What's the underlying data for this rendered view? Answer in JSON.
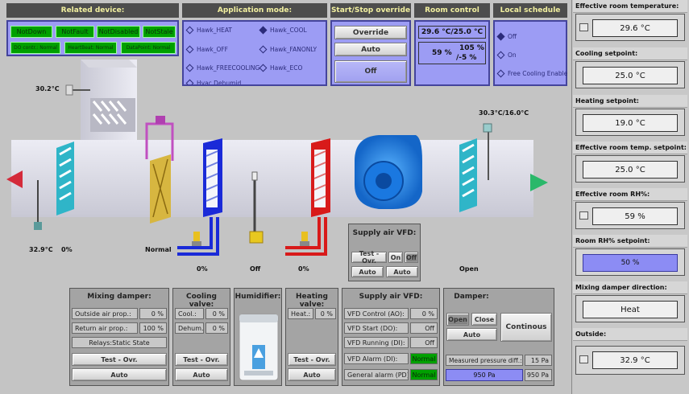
{
  "related_device": {
    "title": "Related device:",
    "status": [
      "NotDown",
      "NotFault",
      "NotDisabled",
      "NotStale"
    ],
    "info": [
      "DO contr.: Normal",
      "HeartBeat: Normal",
      "DataPoint: Normal"
    ]
  },
  "application_mode": {
    "title": "Application mode:",
    "options": [
      "Hawk_HEAT",
      "Hawk_COOL",
      "Hawk_OFF",
      "Hawk_FANONLY",
      "Hawk_FREECOOLING",
      "Hawk_ECO",
      "Hvac Dehumid"
    ],
    "selected": "Hawk_COOL"
  },
  "start_stop": {
    "title": "Start/Stop override",
    "override": "Override",
    "auto": "Auto",
    "off": "Off"
  },
  "room_control": {
    "title": "Room control",
    "temp": "29.6 °C/25.0 °C",
    "rh": "59 %",
    "rh_set": "105 %",
    "rh_diff": "/-5 %"
  },
  "local_schedule": {
    "title": "Local schedule",
    "options": [
      "Off",
      "On",
      "Free Cooling Enable"
    ],
    "selected": "Off"
  },
  "ahu": {
    "exhaust_temp": "30.2°C",
    "outside_temp": "32.9°C",
    "damper_pct": "0%",
    "filter_status": "Normal",
    "cool_valve": "0%",
    "humid": "Off",
    "heat_valve": "0%",
    "supply_temp": "30.3°C/16.0°C",
    "damper_state": "Open"
  },
  "supply_vfd_box": {
    "title": "Supply air VFD:",
    "test": "Test - Ovr.",
    "on": "On",
    "off": "Off",
    "auto": "Auto"
  },
  "mixing_damper": {
    "title": "Mixing damper:",
    "outside_label": "Outside air prop.:",
    "outside_val": "0 %",
    "return_label": "Return air prop.:",
    "return_val": "100 %",
    "relay": "Relays:Static State",
    "test": "Test - Ovr.",
    "auto": "Auto"
  },
  "cooling_valve": {
    "title": "Cooling valve:",
    "cool_label": "Cool.:",
    "cool_val": "0 %",
    "dehum_label": "Dehum.:",
    "dehum_val": "0 %",
    "test": "Test - Ovr.",
    "auto": "Auto"
  },
  "humidifier": {
    "title": "Humidifier:"
  },
  "heating_valve": {
    "title": "Heating valve:",
    "heat_label": "Heat.:",
    "heat_val": "0 %",
    "test": "Test - Ovr.",
    "auto": "Auto"
  },
  "supply_vfd": {
    "title": "Supply air VFD:",
    "rows": [
      {
        "label": "VFD Control (AO):",
        "value": "0 %"
      },
      {
        "label": "VFD Start (DO):",
        "value": "Off"
      },
      {
        "label": "VFD Running (DI):",
        "value": "Off"
      },
      {
        "label": "VFD Alarm (DI):",
        "value": "Normal"
      },
      {
        "label": "General alarm (PD):",
        "value": "Normal"
      }
    ]
  },
  "damper": {
    "title": "Damper:",
    "open": "Open",
    "close": "Close",
    "auto": "Auto",
    "continous": "Continous"
  },
  "pressure": {
    "label": "Measured pressure diff.:",
    "value": "15 Pa",
    "bar": "950 Pa",
    "setpoint": "950 Pa"
  },
  "right_panel": [
    {
      "title": "Effective room temperature:",
      "value": "29.6 °C",
      "icon": true
    },
    {
      "title": "Cooling setpoint:",
      "value": "25.0 °C"
    },
    {
      "title": "Heating setpoint:",
      "value": "19.0 °C"
    },
    {
      "title": "Effective room temp. setpoint:",
      "value": "25.0 °C"
    },
    {
      "title": "Effective room RH%:",
      "value": "59 %",
      "icon": true
    },
    {
      "title": "Room RH% setpoint:",
      "value": "50 %",
      "blue": true
    },
    {
      "title": "Mixing damper direction:",
      "value": "Heat"
    },
    {
      "title": "Outside:",
      "value": "32.9 °C",
      "icon": true
    }
  ],
  "colors": {
    "header_bg": "#4d4d4d",
    "header_text": "#f2f0a0",
    "panel_blue": "#9c9cf4",
    "status_green": "#00a000"
  }
}
